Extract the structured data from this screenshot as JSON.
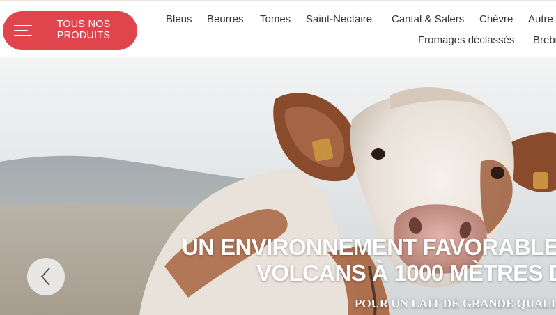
{
  "header": {
    "products_button": {
      "label": "TOUS NOS\nPRODUITS",
      "icon": "menu-icon"
    },
    "nav": {
      "row1": [
        "Bleus",
        "Beurres",
        "Tomes",
        "Saint-Nectaire",
        "Cantal & Salers",
        "Chèvre",
        "Autre"
      ],
      "row2": [
        "Fromages déclassés",
        "Brebi"
      ]
    }
  },
  "hero": {
    "title_line1": "UN ENVIRONNEMENT FAVORABLE",
    "title_line2": "VOLCANS À 1000 MÈTRES D",
    "subtitle": "POUR UN LAIT DE GRANDE QUALI",
    "prev_icon": "chevron-left-icon"
  },
  "colors": {
    "accent": "#e0454e",
    "nav_text": "#333333",
    "hero_text": "#ffffff"
  }
}
